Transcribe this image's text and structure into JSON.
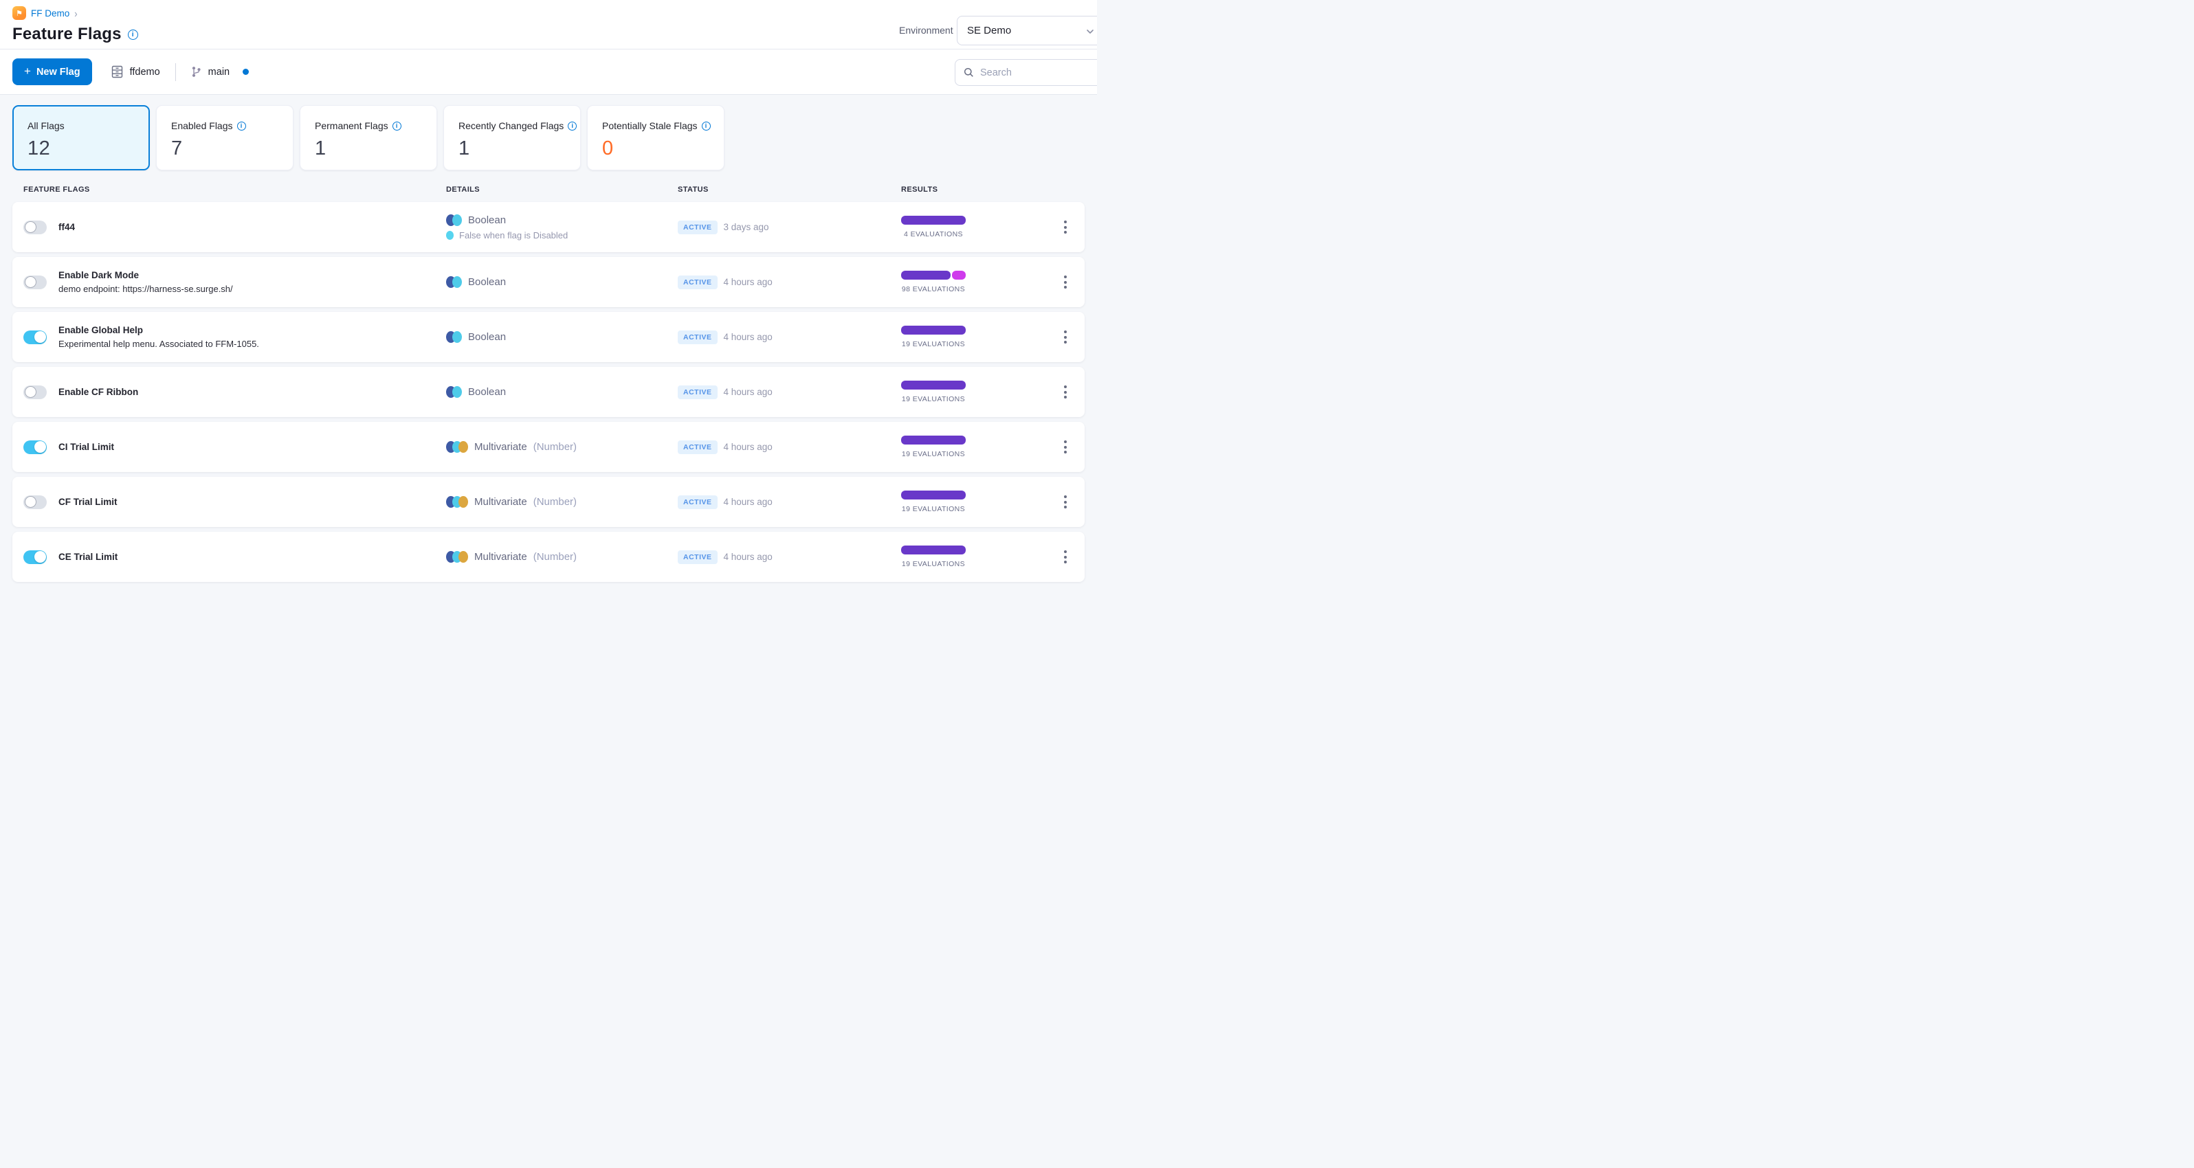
{
  "breadcrumb": {
    "project": "FF Demo"
  },
  "page": {
    "title": "Feature Flags"
  },
  "environment": {
    "label": "Environment",
    "value": "SE Demo"
  },
  "toolbar": {
    "new_flag_plus": "+",
    "new_flag_label": "New Flag",
    "repo": "ffdemo",
    "branch": "main",
    "search_placeholder": "Search"
  },
  "summary_cards": [
    {
      "label": "All Flags",
      "value": "12",
      "selected": true,
      "info": false,
      "value_color": "#3d4150"
    },
    {
      "label": "Enabled Flags",
      "value": "7",
      "selected": false,
      "info": true,
      "value_color": "#3d4150"
    },
    {
      "label": "Permanent Flags",
      "value": "1",
      "selected": false,
      "info": true,
      "value_color": "#3d4150"
    },
    {
      "label": "Recently Changed Flags",
      "value": "1",
      "selected": false,
      "info": true,
      "value_color": "#3d4150"
    },
    {
      "label": "Potentially Stale Flags",
      "value": "0",
      "selected": false,
      "info": true,
      "value_color": "#ff6b26"
    }
  ],
  "table": {
    "headers": [
      "FEATURE FLAGS",
      "DETAILS",
      "STATUS",
      "RESULTS"
    ]
  },
  "flags": [
    {
      "name": "ff44",
      "description": "",
      "enabled": false,
      "type": "Boolean",
      "type_note": "",
      "type_dots": [
        "#3d5aa5",
        "#4ecbe9"
      ],
      "default_note": "False when flag is Disabled",
      "status": "ACTIVE",
      "updated": "3 days ago",
      "evaluations": "4 EVALUATIONS",
      "bar": [
        {
          "w": 94,
          "color": "#6938c9"
        }
      ]
    },
    {
      "name": "Enable Dark Mode",
      "description": "demo endpoint: https://harness-se.surge.sh/",
      "enabled": false,
      "type": "Boolean",
      "type_note": "",
      "type_dots": [
        "#3d5aa5",
        "#4ecbe9"
      ],
      "default_note": "",
      "status": "ACTIVE",
      "updated": "4 hours ago",
      "evaluations": "98 EVALUATIONS",
      "bar": [
        {
          "w": 72,
          "color": "#6938c9"
        },
        {
          "w": 20,
          "color": "#cf3bec"
        }
      ]
    },
    {
      "name": "Enable Global Help",
      "description": "Experimental help menu. Associated to FFM-1055.",
      "enabled": true,
      "type": "Boolean",
      "type_note": "",
      "type_dots": [
        "#3d5aa5",
        "#4ecbe9"
      ],
      "default_note": "",
      "status": "ACTIVE",
      "updated": "4 hours ago",
      "evaluations": "19 EVALUATIONS",
      "bar": [
        {
          "w": 94,
          "color": "#6938c9"
        }
      ]
    },
    {
      "name": "Enable CF Ribbon",
      "description": "",
      "enabled": false,
      "type": "Boolean",
      "type_note": "",
      "type_dots": [
        "#3d5aa5",
        "#4ecbe9"
      ],
      "default_note": "",
      "status": "ACTIVE",
      "updated": "4 hours ago",
      "evaluations": "19 EVALUATIONS",
      "bar": [
        {
          "w": 94,
          "color": "#6938c9"
        }
      ]
    },
    {
      "name": "CI Trial Limit",
      "description": "",
      "enabled": true,
      "type": "Multivariate",
      "type_note": "(Number)",
      "type_dots": [
        "#3d5aa5",
        "#4ecbe9",
        "#dca63f"
      ],
      "default_note": "",
      "status": "ACTIVE",
      "updated": "4 hours ago",
      "evaluations": "19 EVALUATIONS",
      "bar": [
        {
          "w": 94,
          "color": "#6938c9"
        }
      ]
    },
    {
      "name": "CF Trial Limit",
      "description": "",
      "enabled": false,
      "type": "Multivariate",
      "type_note": "(Number)",
      "type_dots": [
        "#3d5aa5",
        "#4ecbe9",
        "#dca63f"
      ],
      "default_note": "",
      "status": "ACTIVE",
      "updated": "4 hours ago",
      "evaluations": "19 EVALUATIONS",
      "bar": [
        {
          "w": 94,
          "color": "#6938c9"
        }
      ]
    },
    {
      "name": "CE Trial Limit",
      "description": "",
      "enabled": true,
      "type": "Multivariate",
      "type_note": "(Number)",
      "type_dots": [
        "#3d5aa5",
        "#4ecbe9",
        "#dca63f"
      ],
      "default_note": "",
      "status": "ACTIVE",
      "updated": "4 hours ago",
      "evaluations": "19 EVALUATIONS",
      "bar": [
        {
          "w": 94,
          "color": "#6938c9"
        }
      ]
    }
  ],
  "colors": {
    "primary": "#0278d5",
    "toggle_on": "#3fc3f2",
    "bar_purple": "#6938c9",
    "bar_magenta": "#cf3bec",
    "stale_orange": "#ff6b26"
  }
}
